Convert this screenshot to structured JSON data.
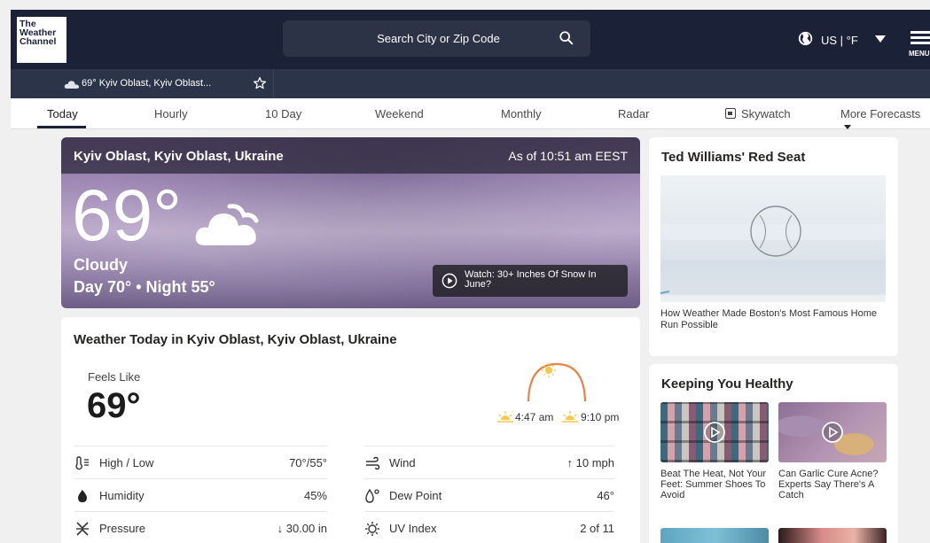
{
  "header": {
    "logo_lines": [
      "The",
      "Weather",
      "Channel"
    ],
    "search_placeholder": "Search City or Zip Code",
    "units": "US | °F",
    "menu_label": "MENU"
  },
  "location_bar": {
    "item": "69° Kyiv Oblast, Kyiv Oblast..."
  },
  "tabs": [
    "Today",
    "Hourly",
    "10 Day",
    "Weekend",
    "Monthly",
    "Radar",
    "Skywatch",
    "More Forecasts"
  ],
  "hero": {
    "location": "Kyiv Oblast, Kyiv Oblast, Ukraine",
    "as_of": "As of 10:51 am EEST",
    "temperature": "69°",
    "condition": "Cloudy",
    "day_night": "Day 70° • Night 55°",
    "video_label": "Watch: 30+ Inches Of Snow In June?"
  },
  "today": {
    "title": "Weather Today in Kyiv Oblast, Kyiv Oblast, Ukraine",
    "feels_like_label": "Feels Like",
    "feels_like_value": "69°",
    "sunrise": "4:47 am",
    "sunset": "9:10 pm",
    "left_rows": [
      {
        "label": "High / Low",
        "value": "70°/55°",
        "icon": "thermometer-icon"
      },
      {
        "label": "Humidity",
        "value": "45%",
        "icon": "humidity-icon"
      },
      {
        "label": "Pressure",
        "value": "↓ 30.00 in",
        "icon": "pressure-icon"
      }
    ],
    "right_rows": [
      {
        "label": "Wind",
        "value": "↑ 10 mph",
        "icon": "wind-icon"
      },
      {
        "label": "Dew Point",
        "value": "46°",
        "icon": "dew-point-icon"
      },
      {
        "label": "UV Index",
        "value": "2 of 11",
        "icon": "uv-index-icon"
      }
    ]
  },
  "side_story": {
    "title": "Ted Williams' Red Seat",
    "caption": "How Weather Made Boston's Most Famous Home Run Possible"
  },
  "healthy": {
    "title": "Keeping You Healthy",
    "items": [
      {
        "caption": "Beat The Heat, Not Your Feet: Summer Shoes To Avoid"
      },
      {
        "caption": "Can Garlic Cure Acne? Experts Say There's A Catch"
      }
    ]
  },
  "colors": {
    "header_bg": "#1b2136",
    "location_bar_bg": "#2b3449",
    "sun_arc": "#e8824a",
    "sun_icon": "#f2c94c"
  }
}
